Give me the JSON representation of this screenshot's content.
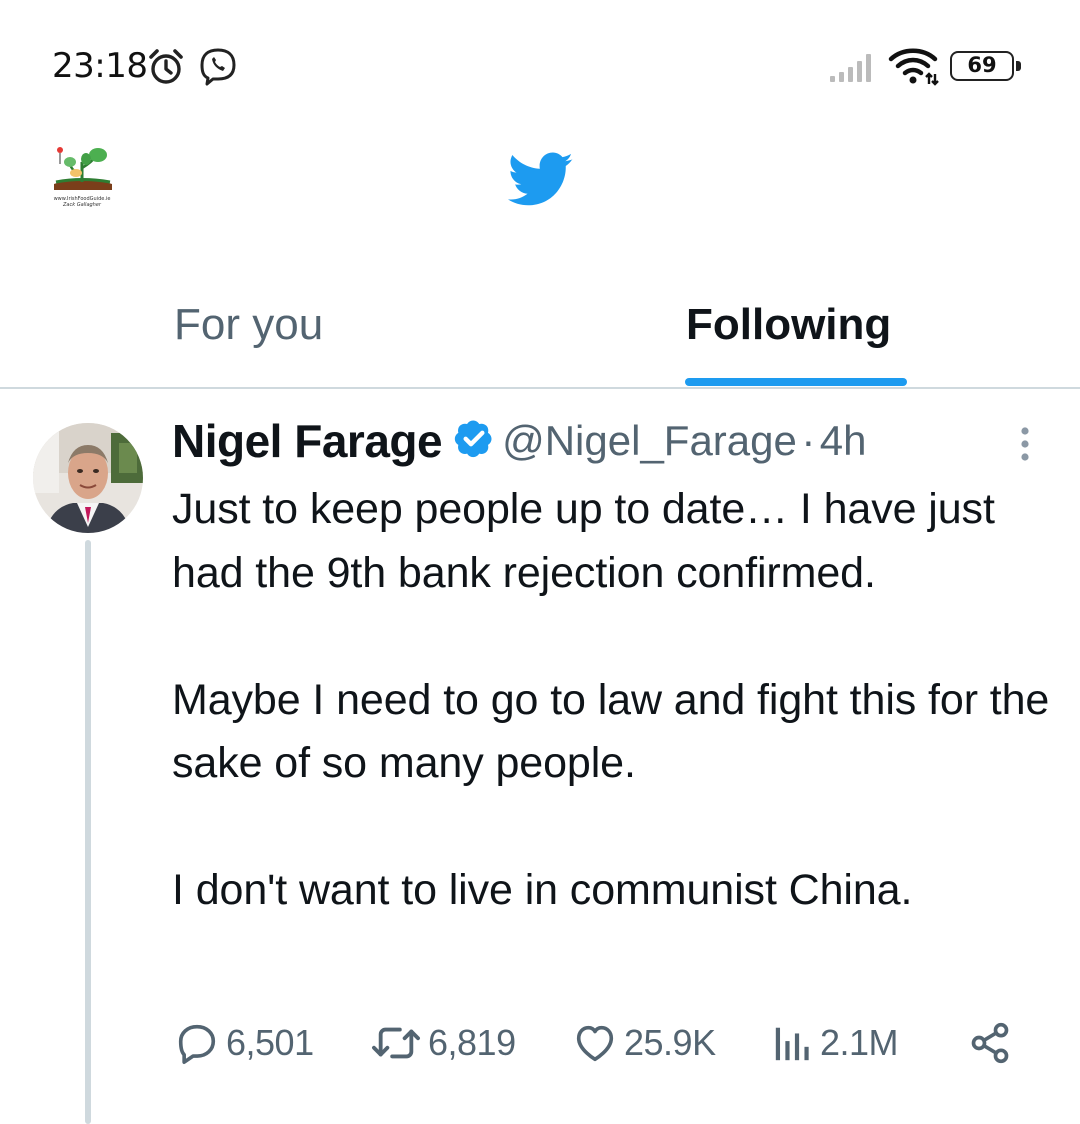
{
  "status_bar": {
    "time": "23:18",
    "battery": "69",
    "icons": [
      "alarm-icon",
      "viber-icon",
      "signal-icon",
      "wifi-icon",
      "battery-icon"
    ]
  },
  "top_bar": {
    "profile_caption_1": "www.IrishFoodGuide.ie",
    "profile_caption_2": "Zack Gallagher",
    "logo": "twitter-bird-icon",
    "brand_color": "#1d9bf0"
  },
  "tabs": [
    {
      "label": "For you",
      "active": false
    },
    {
      "label": "Following",
      "active": true
    }
  ],
  "tweet": {
    "author": {
      "display_name": "Nigel Farage",
      "handle": "@Nigel_Farage",
      "verified": true
    },
    "separator": "·",
    "time_ago": "4h",
    "paragraphs": [
      "Just to keep people up to date… I have just had the 9th bank rejection confirmed.",
      "Maybe I need to go to law and fight this for the sake of so many people.",
      "I don't want to live in communist China."
    ],
    "stats": {
      "replies": "6,501",
      "retweets": "6,819",
      "likes": "25.9K",
      "views": "2.1M"
    }
  },
  "colors": {
    "text_primary": "#0f1419",
    "text_secondary": "#536471",
    "accent": "#1d9bf0",
    "divider": "#cfd9de"
  }
}
